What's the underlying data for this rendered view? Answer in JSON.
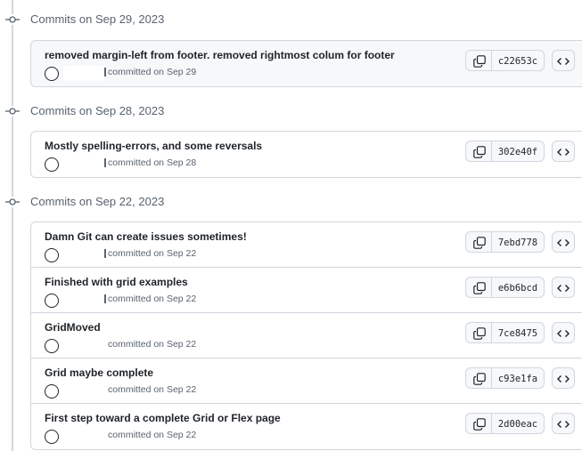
{
  "groups": [
    {
      "title": "Commits on Sep 29, 2023",
      "commits": [
        {
          "message": "removed margin-left from footer. removed rightmost colum for footer",
          "meta": "committed on Sep 29",
          "sha": "c22653c"
        }
      ]
    },
    {
      "title": "Commits on Sep 28, 2023",
      "commits": [
        {
          "message": "Mostly spelling-errors, and some reversals",
          "meta": "committed on Sep 28",
          "sha": "302e40f"
        }
      ]
    },
    {
      "title": "Commits on Sep 22, 2023",
      "commits": [
        {
          "message": "Damn Git can create issues sometimes!",
          "meta": "committed on Sep 22",
          "sha": "7ebd778"
        },
        {
          "message": "Finished with grid examples",
          "meta": "committed on Sep 22",
          "sha": "e6b6bcd"
        },
        {
          "message": "GridMoved",
          "meta": "committed on Sep 22",
          "sha": "7ce8475"
        },
        {
          "message": "Grid maybe complete",
          "meta": "committed on Sep 22",
          "sha": "c93e1fa"
        },
        {
          "message": "First step toward a complete Grid or Flex page",
          "meta": "committed on Sep 22",
          "sha": "2d00eac"
        }
      ]
    }
  ],
  "icons": {
    "commit_node": "git-commit-icon",
    "avatar": "avatar-circle",
    "copy": "copy-icon",
    "browse": "code-icon"
  },
  "colors": {
    "border": "#d0d7de",
    "muted_text": "#59636e",
    "text": "#1f2328",
    "button_bg": "#f6f8fa"
  }
}
